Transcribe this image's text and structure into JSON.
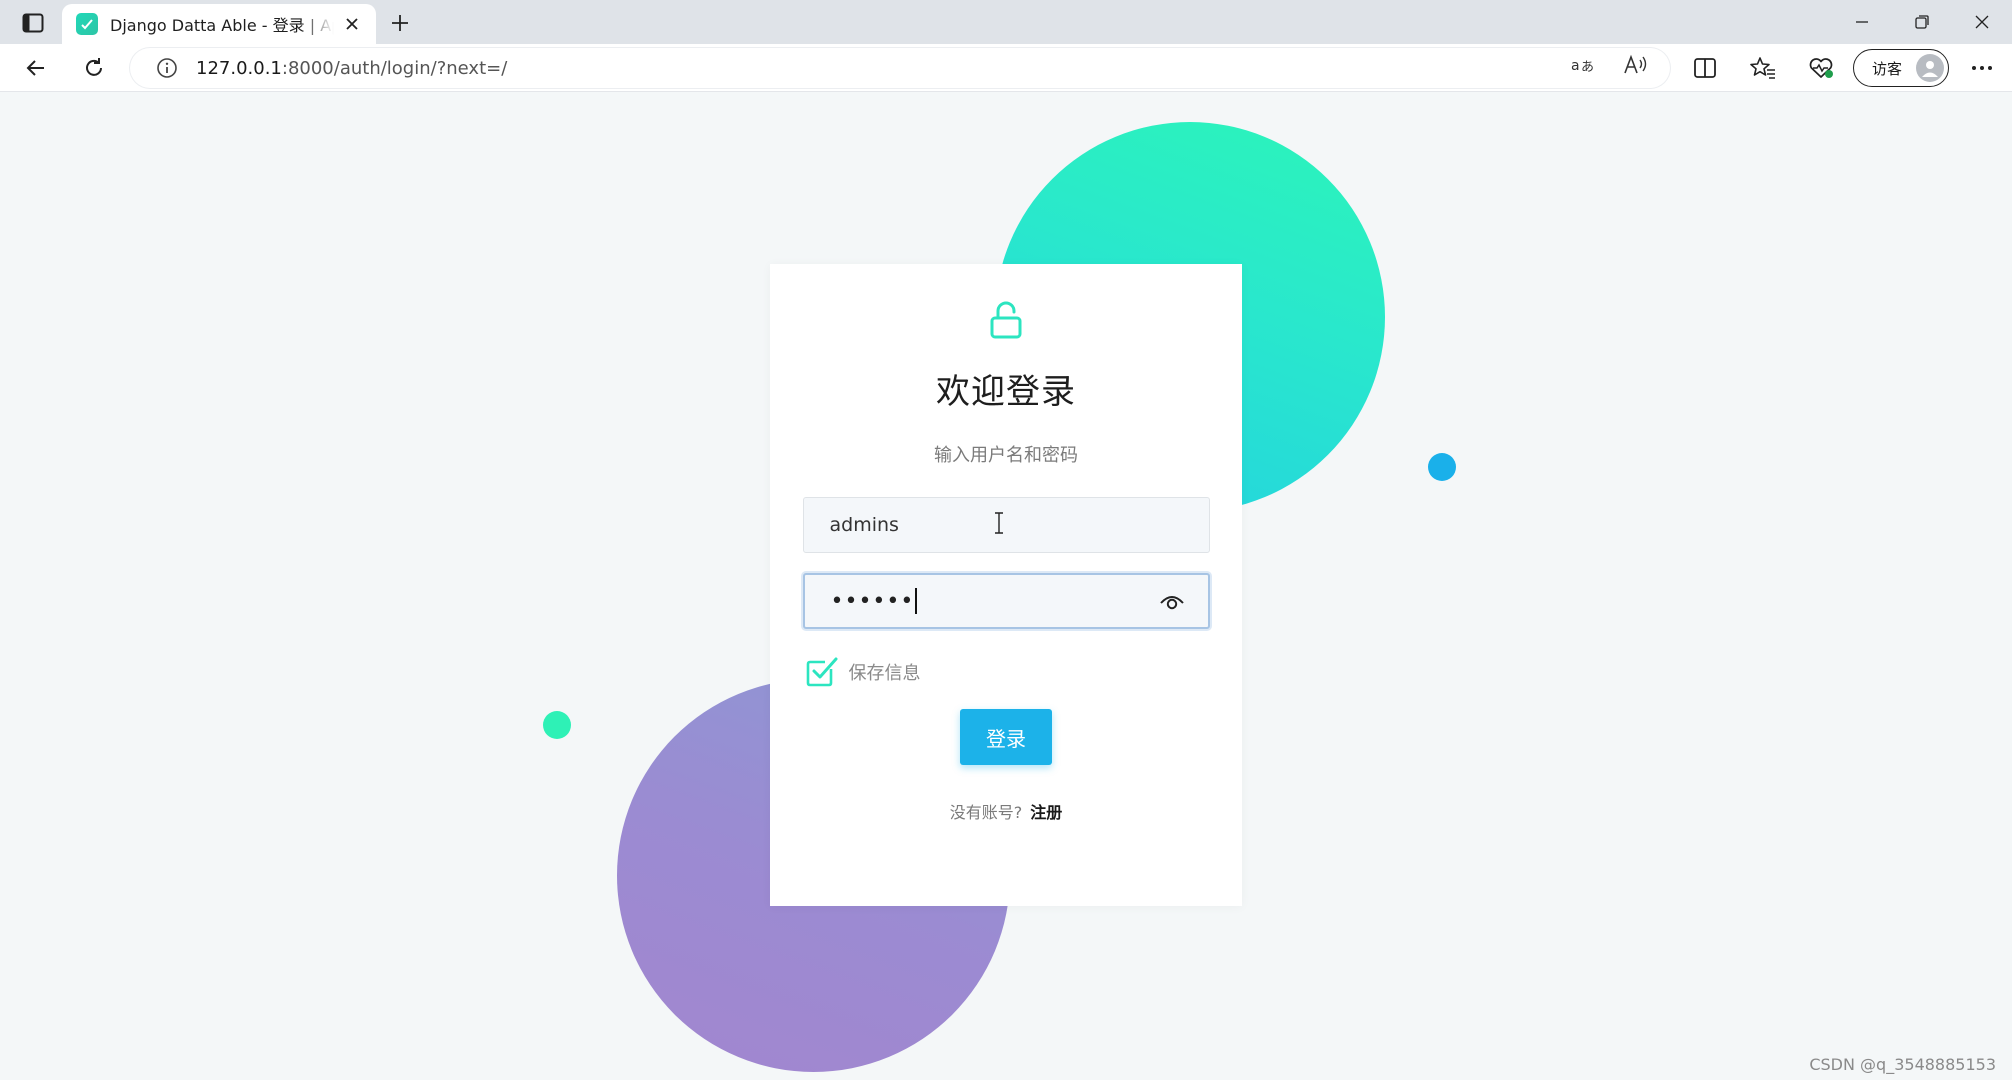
{
  "browser": {
    "tab": {
      "title": "Django Datta Able - 登录 | AppSeed"
    },
    "address": {
      "host": "127.0.0.1",
      "path": ":8000/auth/login/?next=/"
    },
    "profile": {
      "label": "访客"
    }
  },
  "login": {
    "title": "欢迎登录",
    "subtitle": "输入用户名和密码",
    "username_value": "admins",
    "password_masked": "••••••",
    "remember_label": "保存信息",
    "remember_checked": true,
    "submit_label": "登录",
    "no_account_text": "没有账号?",
    "signup_link": "注册"
  },
  "colors": {
    "accent_green": "#2cf5b9",
    "primary_button": "#1cb2e9",
    "purple": "#9b8bd2",
    "dot_blue": "#1ab0ea"
  },
  "watermark": "CSDN @q_3548885153"
}
